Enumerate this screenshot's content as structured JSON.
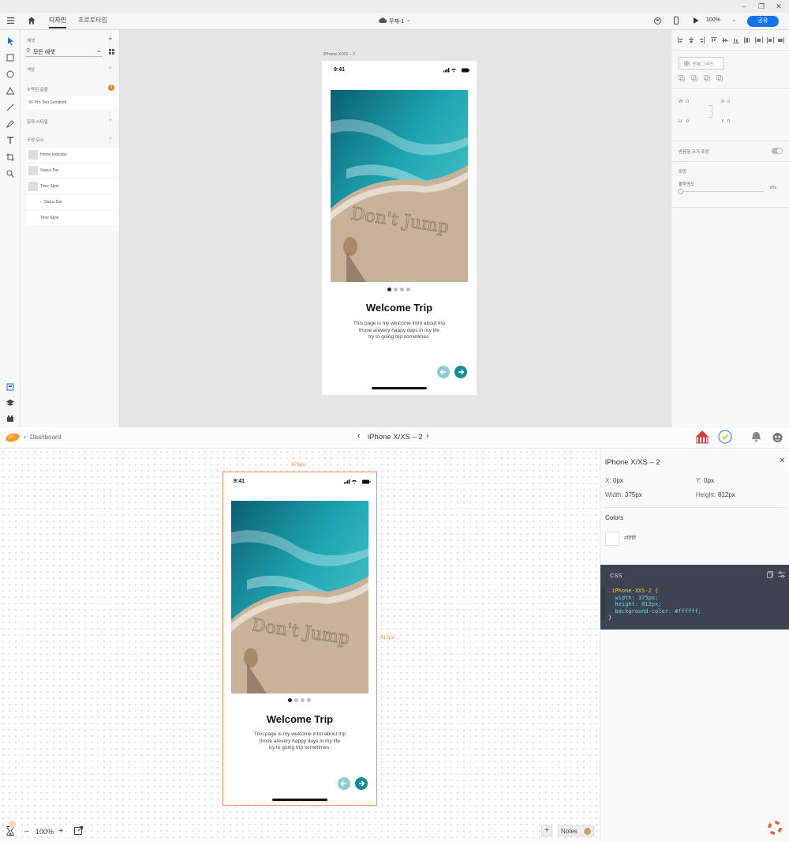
{
  "xd": {
    "tabs": {
      "design": "디자인",
      "prototype": "프로토타입"
    },
    "doc_title": "무제-1",
    "zoom": "100%",
    "share_label": "공유",
    "left_panel": {
      "assets_label": "에셋",
      "search_value": "모든 에셋",
      "colors_label": "색상",
      "char_styles_label": "누락된 글꼴",
      "font_name": "SF Pro Text Semibold",
      "text_styles_label": "문자 스타일",
      "components_label": "구성 요소",
      "components": [
        "Home Indicator",
        "Status Bar",
        "Time Style",
        "– Status Bar",
        "Time Style"
      ]
    },
    "artboard_label": "iPhone X/XS – 2",
    "right_panel": {
      "repeat_grid_label": "반복 그리드",
      "w_label": "W",
      "w_value": "0",
      "h_label": "H",
      "h_value": "0",
      "x_label": "X",
      "x_value": "0",
      "y_label": "Y",
      "y_value": "0",
      "responsive_label": "반응형 크기 조정",
      "appearance_label": "모양",
      "opacity_label": "불투명도",
      "opacity_value": "0%"
    }
  },
  "screen": {
    "time": "9:41",
    "title": "Welcome Trip",
    "body_lines": [
      "This page is my welcome intro about trip",
      "those arevery happy days in my life",
      "try to going trip sometimes."
    ],
    "image_caption": "Don't Jump",
    "dots": 4,
    "active_dot": 0
  },
  "zeplin": {
    "back_label": "Dashboard",
    "screen_name": "iPhone X/XS – 2",
    "width_marker": "375px",
    "height_marker": "812px",
    "zoom": "100%",
    "notes_label": "Notes",
    "inspector": {
      "title": "iPhone X/XS – 2",
      "x_label": "X:",
      "x_value": "0px",
      "y_label": "Y:",
      "y_value": "0px",
      "width_label": "Width:",
      "width_value": "375px",
      "height_label": "Height:",
      "height_value": "812px",
      "colors_label": "Colors",
      "color_hex": "#ffffff",
      "css_label": "CSS",
      "css_lines": [
        ".iPhone-XXS-2 {",
        "  width: 375px;",
        "  height: 812px;",
        "  background-color: #ffffff;",
        "}"
      ]
    }
  },
  "colors": {
    "accent_blue": "#1473e6",
    "teal": "#0f8c94",
    "teal_light": "#8fcbd1",
    "zeplin_orange": "#f08b5b"
  }
}
